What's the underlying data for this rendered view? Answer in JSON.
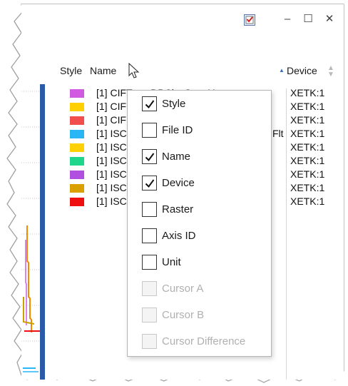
{
  "titlebar": {
    "app_icon": "checklist-icon",
    "minimize_label": "–",
    "maximize_label": "☐",
    "close_label": "✕",
    "accent": "#2b5aa8"
  },
  "header": {
    "style_label": "Style",
    "name_label": "Name",
    "sort_indicator": "▲",
    "device_label": "Device"
  },
  "rows": [
    {
      "name": "[1] CIF",
      "device": "XETK:1",
      "color": "#d05ae0"
    },
    {
      "name": "[1] CIF",
      "device": "XETK:1",
      "color": "#ffd000"
    },
    {
      "name": "[1] CIF",
      "device": "XETK:1",
      "color": "#f24e4e"
    },
    {
      "name": "[1] ISC",
      "device": "XETK:1",
      "color": "#29b6f6"
    },
    {
      "name": "[1] ISC",
      "device": "XETK:1",
      "color": "#ffd000"
    },
    {
      "name": "[1] ISC",
      "device": "XETK:1",
      "color": "#1fd68a"
    },
    {
      "name": "[1] ISC",
      "device": "XETK:1",
      "color": "#b04fe0"
    },
    {
      "name": "[1] ISC",
      "device": "XETK:1",
      "color": "#d9a000"
    },
    {
      "name": "[1] ISC",
      "device": "XETK:1",
      "color": "#ee1010"
    }
  ],
  "row_fragments": {
    "row1_tail": "TarnxDBCl:s.SonaU",
    "row4_tail": "Flt"
  },
  "context_menu": {
    "items": [
      {
        "label": "Style",
        "checked": true,
        "enabled": true
      },
      {
        "label": "File ID",
        "checked": false,
        "enabled": true
      },
      {
        "label": "Name",
        "checked": true,
        "enabled": true
      },
      {
        "label": "Device",
        "checked": true,
        "enabled": true
      },
      {
        "label": "Raster",
        "checked": false,
        "enabled": true
      },
      {
        "label": "Axis ID",
        "checked": false,
        "enabled": true
      },
      {
        "label": "Unit",
        "checked": false,
        "enabled": true
      },
      {
        "label": "Cursor A",
        "checked": false,
        "enabled": false
      },
      {
        "label": "Cursor B",
        "checked": false,
        "enabled": false
      },
      {
        "label": "Cursor Difference",
        "checked": false,
        "enabled": false
      }
    ]
  }
}
